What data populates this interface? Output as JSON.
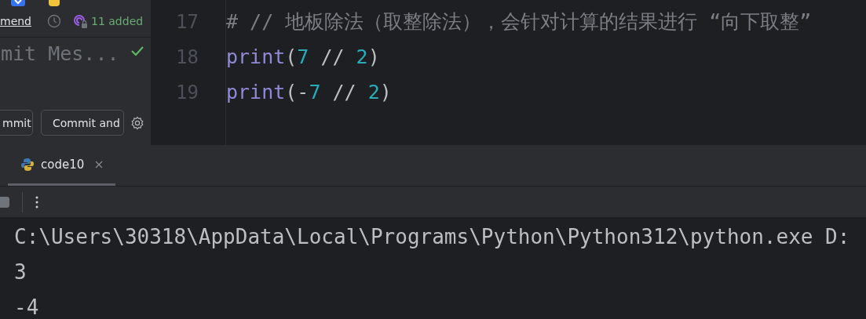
{
  "commit_panel": {
    "amend_label": "mend",
    "changes": "11 added",
    "message": {
      "placeholder": "mit Mes..."
    },
    "buttons": [
      "mmit",
      "Commit and"
    ]
  },
  "editor": {
    "lines": [
      {
        "number": "17",
        "tokens": [
          {
            "kind": "comment",
            "text": "# // 地板除法（取整除法），会针对计算的结果进行 “向下取整”"
          }
        ]
      },
      {
        "number": "18",
        "tokens": [
          {
            "kind": "builtin",
            "text": "print"
          },
          {
            "kind": "paren",
            "text": "("
          },
          {
            "kind": "number",
            "text": "7"
          },
          {
            "kind": "operator",
            "text": " // "
          },
          {
            "kind": "number",
            "text": "2"
          },
          {
            "kind": "paren",
            "text": ")"
          }
        ]
      },
      {
        "number": "19",
        "tokens": [
          {
            "kind": "builtin",
            "text": "print"
          },
          {
            "kind": "paren",
            "text": "("
          },
          {
            "kind": "operator",
            "text": "-"
          },
          {
            "kind": "number",
            "text": "7"
          },
          {
            "kind": "operator",
            "text": " // "
          },
          {
            "kind": "number",
            "text": "2"
          },
          {
            "kind": "paren",
            "text": ")"
          }
        ]
      }
    ]
  },
  "run_panel": {
    "tabs": [
      {
        "label": "code10",
        "selected": true
      }
    ],
    "output": [
      "C:\\Users\\30318\\AppData\\Local\\Programs\\Python\\Python312\\python.exe D:",
      "3",
      "-4"
    ]
  }
}
